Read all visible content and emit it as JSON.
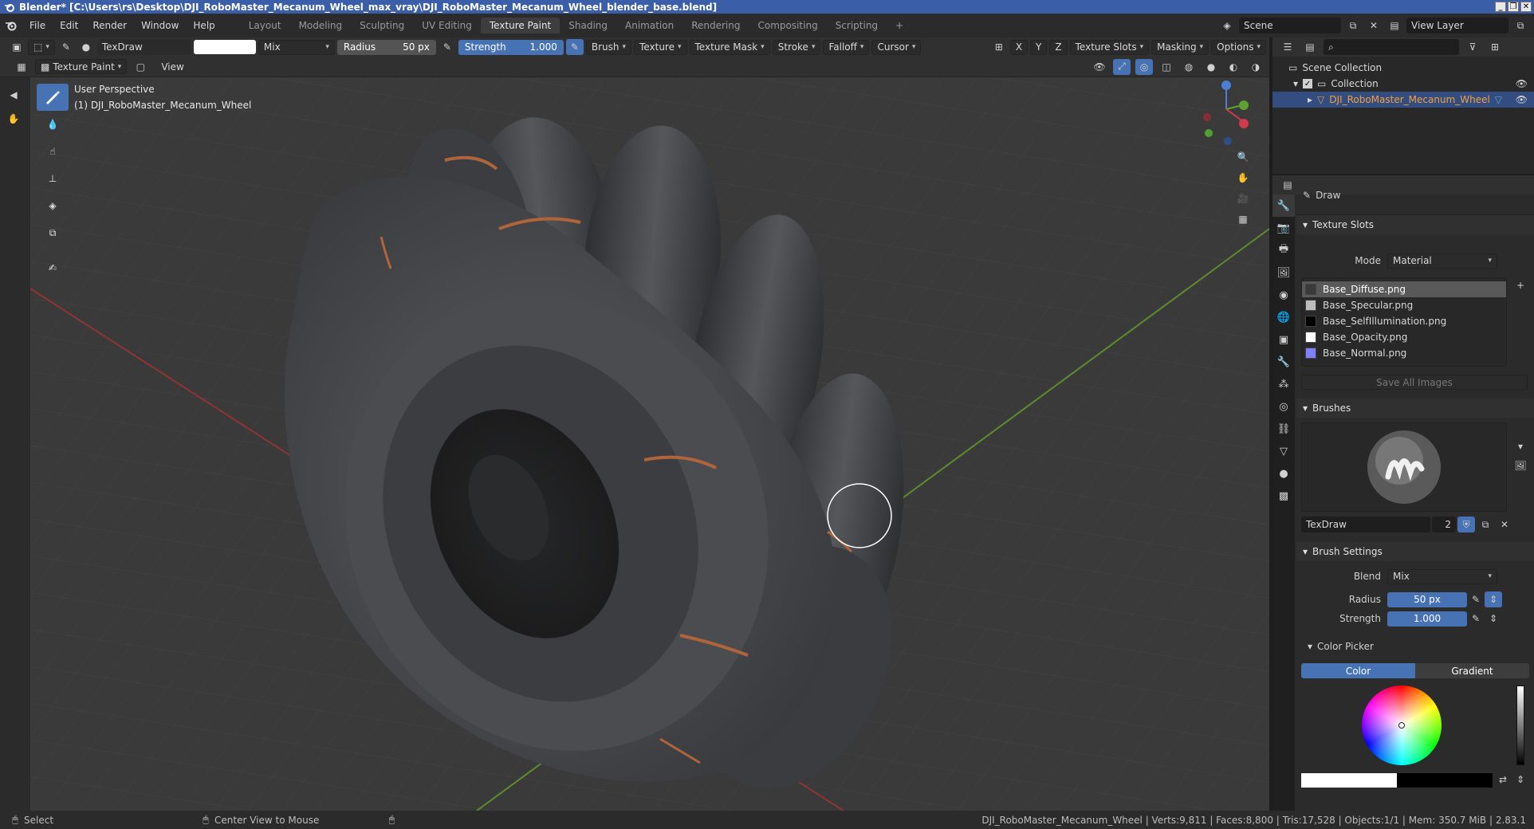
{
  "window": {
    "title": "Blender* [C:\\Users\\rs\\Desktop\\DJI_RoboMaster_Mecanum_Wheel_max_vray\\DJI_RoboMaster_Mecanum_Wheel_blender_base.blend]"
  },
  "menu": [
    "File",
    "Edit",
    "Render",
    "Window",
    "Help"
  ],
  "workspaces": [
    "Layout",
    "Modeling",
    "Sculpting",
    "UV Editing",
    "Texture Paint",
    "Shading",
    "Animation",
    "Rendering",
    "Compositing",
    "Scripting"
  ],
  "active_workspace": "Texture Paint",
  "scene": {
    "scene_name": "Scene",
    "view_layer": "View Layer"
  },
  "toolheader": {
    "brush_name": "TexDraw",
    "blend": "Mix",
    "radius_label": "Radius",
    "radius_value": "50 px",
    "strength_label": "Strength",
    "strength_value": "1.000",
    "menus": [
      "Brush",
      "Texture",
      "Texture Mask",
      "Stroke",
      "Falloff",
      "Cursor"
    ],
    "axes": [
      "X",
      "Y",
      "Z"
    ],
    "right_menus": [
      "Texture Slots",
      "Masking",
      "Options"
    ]
  },
  "subheader": {
    "mode": "Texture Paint",
    "view": "View"
  },
  "viewport": {
    "perspective": "User Perspective",
    "object": "(1) DJI_RoboMaster_Mecanum_Wheel"
  },
  "outliner": {
    "root": "Scene Collection",
    "collection": "Collection",
    "object": "DJI_RoboMaster_Mecanum_Wheel"
  },
  "properties": {
    "tool_name": "Draw",
    "texture_slots": {
      "title": "Texture Slots",
      "mode_label": "Mode",
      "mode_value": "Material",
      "items": [
        {
          "name": "Base_Diffuse.png",
          "color": "#3a3a3a"
        },
        {
          "name": "Base_Specular.png",
          "color": "#bdbdbd"
        },
        {
          "name": "Base_SelfIllumination.png",
          "color": "#000000"
        },
        {
          "name": "Base_Opacity.png",
          "color": "#ffffff"
        },
        {
          "name": "Base_Normal.png",
          "color": "#8080ff"
        }
      ],
      "save_all": "Save All Images"
    },
    "brushes": {
      "title": "Brushes",
      "name": "TexDraw",
      "users": "2"
    },
    "brush_settings": {
      "title": "Brush Settings",
      "blend_label": "Blend",
      "blend_value": "Mix",
      "radius_label": "Radius",
      "radius_value": "50 px",
      "strength_label": "Strength",
      "strength_value": "1.000"
    },
    "color_picker": {
      "title": "Color Picker",
      "tab_color": "Color",
      "tab_gradient": "Gradient"
    }
  },
  "statusbar": {
    "select": "Select",
    "center_view": "Center View to Mouse",
    "stats": "DJI_RoboMaster_Mecanum_Wheel | Verts:9,811 | Faces:8,800 | Tris:17,528 | Objects:1/1 | Mem: 350.7 MiB | 2.83.1"
  }
}
